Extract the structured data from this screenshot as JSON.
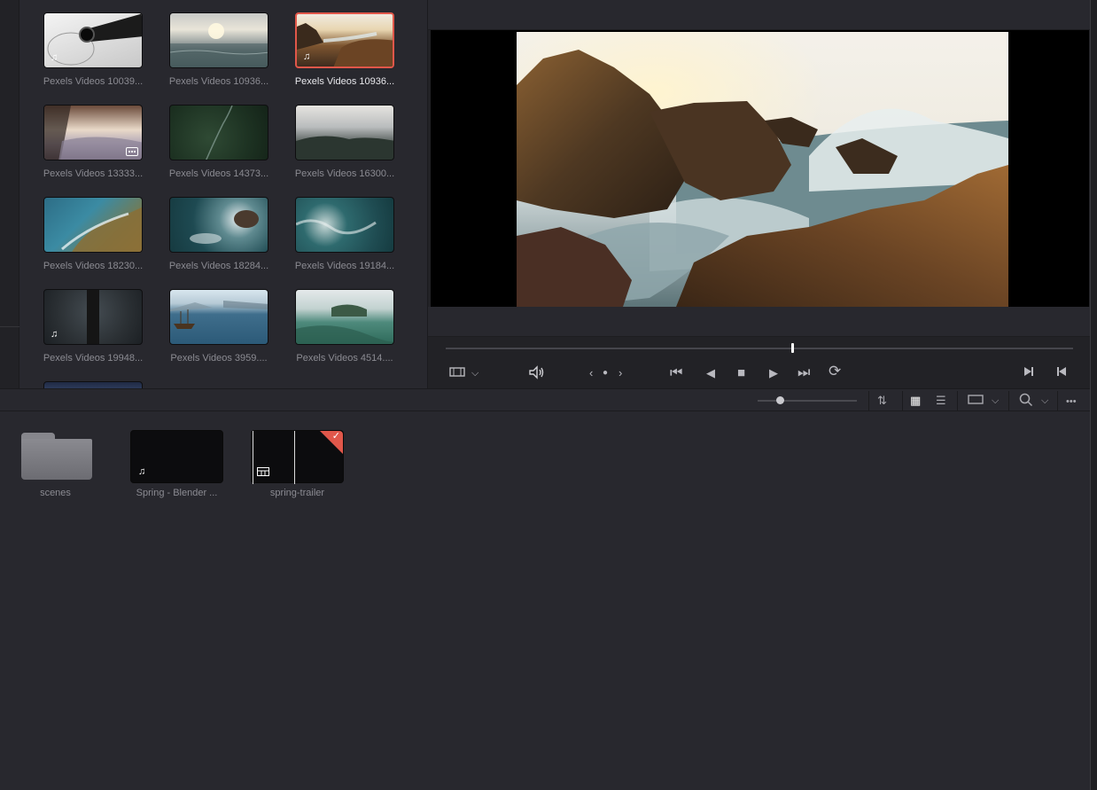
{
  "media_pool": {
    "clips": [
      {
        "label": "Pexels Videos 10039...",
        "badge": "audio",
        "selected": false
      },
      {
        "label": "Pexels Videos 10936...",
        "badge": "",
        "selected": false
      },
      {
        "label": "Pexels Videos 10936...",
        "badge": "audio",
        "selected": true
      },
      {
        "label": "Pexels Videos 13333...",
        "badge": "subtitle",
        "selected": false
      },
      {
        "label": "Pexels Videos 14373...",
        "badge": "",
        "selected": false
      },
      {
        "label": "Pexels Videos 16300...",
        "badge": "",
        "selected": false
      },
      {
        "label": "Pexels Videos 18230...",
        "badge": "",
        "selected": false
      },
      {
        "label": "Pexels Videos 18284...",
        "badge": "",
        "selected": false
      },
      {
        "label": "Pexels Videos 19184...",
        "badge": "",
        "selected": false
      },
      {
        "label": "Pexels Videos 19948...",
        "badge": "audio",
        "selected": false
      },
      {
        "label": "Pexels Videos 3959....",
        "badge": "",
        "selected": false
      },
      {
        "label": "Pexels Videos 4514....",
        "badge": "",
        "selected": false
      }
    ]
  },
  "viewer": {
    "controls": {
      "clip_view_icon": "film-icon",
      "volume_icon": "speaker-icon",
      "prev": "‹",
      "next": "›",
      "dot": "●",
      "skip_start": "⏮",
      "step_back": "◀",
      "stop": "■",
      "play": "▶",
      "skip_end": "⏭",
      "loop": "⟳",
      "mark_in": "mark-in-icon",
      "mark_out": "mark-out-icon"
    }
  },
  "bin_toolbar": {
    "sort": "⇅",
    "grid": "▦",
    "list": "☰",
    "more": "•••"
  },
  "bin": {
    "items": [
      {
        "label": "scenes",
        "type": "folder"
      },
      {
        "label": "Spring - Blender ...",
        "type": "audio-clip"
      },
      {
        "label": "spring-trailer",
        "type": "timeline"
      }
    ]
  },
  "colors": {
    "selection": "#e0574a",
    "panel": "#28282e",
    "text": "#8b8b92"
  }
}
